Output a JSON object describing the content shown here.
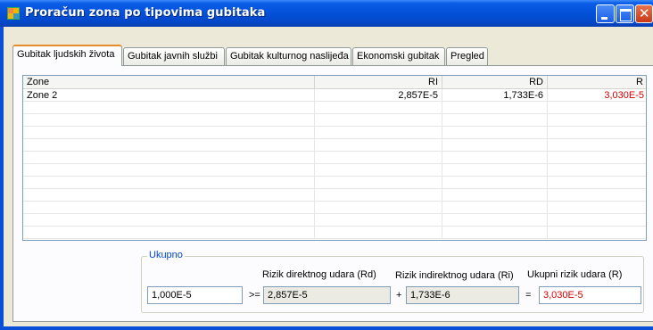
{
  "window": {
    "title": "Proračun zona  po tipovima gubitaka",
    "close_glyph": "✕"
  },
  "tabs": [
    {
      "label": "Gubitak ljudskih života",
      "active": true
    },
    {
      "label": "Gubitak javnih službi",
      "active": false
    },
    {
      "label": "Gubitak kulturnog naslijeđa",
      "active": false
    },
    {
      "label": "Ekonomski gubitak",
      "active": false
    },
    {
      "label": "Pregled",
      "active": false
    }
  ],
  "grid": {
    "columns": [
      "Zone",
      "RI",
      "RD",
      "R"
    ],
    "rows": [
      {
        "zone": "Zone 2",
        "ri": "2,857E-5",
        "rd": "1,733E-6",
        "r": "3,030E-5"
      }
    ]
  },
  "ukupno": {
    "group_label": "Ukupno",
    "threshold_value": "1,000E-5",
    "op_ge": ">=",
    "op_plus": "+",
    "op_eq": "=",
    "rd_label": "Rizik direktnog udara (Rd)",
    "rd_value": "2,857E-5",
    "ri_label": "Rizik indirektnog udara (Ri)",
    "ri_value": "1,733E-6",
    "r_label": "Ukupni rizik udara (R)",
    "r_value": "3,030E-5"
  },
  "colors": {
    "titlebar": "#0450d8",
    "face": "#ece9d8",
    "accent_red": "#d00000",
    "group_label": "#0046d5"
  }
}
